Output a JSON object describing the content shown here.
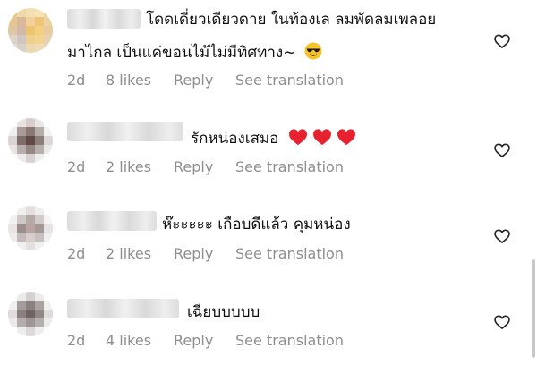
{
  "comments": [
    {
      "text": "โดดเดี่ยวเดียวดาย ในท้องเล ลมพัดลมเพลอย",
      "text_line2": "มาไกล เป็นแค่ขอนไม้ไม่มีทิศทาง~",
      "emoji": "sunglasses-emoji",
      "time": "2d",
      "likes": "8 likes",
      "reply": "Reply",
      "translate": "See translation"
    },
    {
      "text": "รักหน่องเสมอ",
      "emoji": "red-heart-emoji",
      "time": "2d",
      "likes": "2 likes",
      "reply": "Reply",
      "translate": "See translation"
    },
    {
      "text": "ห๊ะะะะะ เกือบดีแล้ว คุมหน่อง",
      "time": "2d",
      "likes": "2 likes",
      "reply": "Reply",
      "translate": "See translation"
    },
    {
      "text": "เฉียบบบบบ",
      "time": "2d",
      "likes": "4 likes",
      "reply": "Reply",
      "translate": "See translation"
    }
  ],
  "colors": {
    "meta_text": "#8e8e8e",
    "heart_emoji": "#e8212f",
    "like_outline": "#262626"
  }
}
